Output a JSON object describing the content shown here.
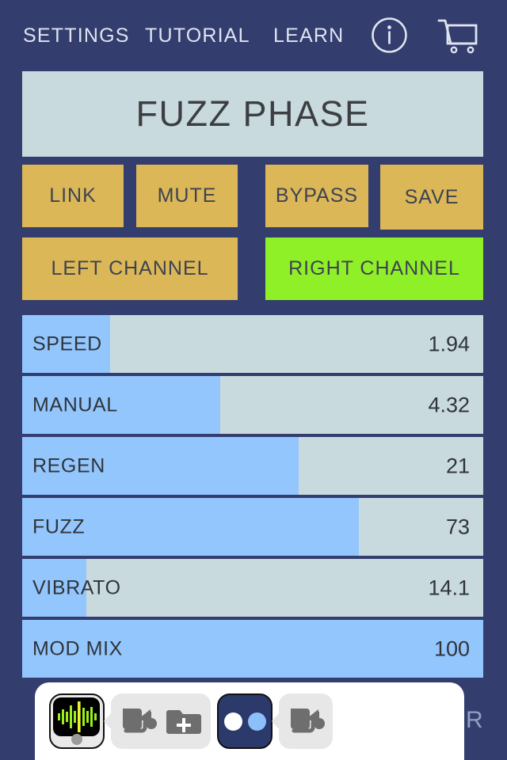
{
  "app": {
    "background_color": "#333d6e",
    "title": "FUZZ PHASE"
  },
  "topnav": {
    "settings_label": "SETTINGS",
    "tutorial_label": "TUTORIAL",
    "learn_label": "LEARN",
    "info_icon": "info-circle-icon",
    "cart_icon": "shopping-cart-icon"
  },
  "actions": {
    "link_label": "LINK",
    "mute_label": "MUTE",
    "bypass_label": "BYPASS",
    "save_label": "SAVE",
    "inactive_color": "#dcb757",
    "active_color": "#90f028"
  },
  "channels": {
    "left_label": "LEFT CHANNEL",
    "right_label": "RIGHT CHANNEL",
    "selected": "RIGHT CHANNEL"
  },
  "parameters": [
    {
      "name": "SPEED",
      "value": "1.94",
      "fill_percent": 19
    },
    {
      "name": "MANUAL",
      "value": "4.32",
      "fill_percent": 43
    },
    {
      "name": "REGEN",
      "value": "21",
      "fill_percent": 60
    },
    {
      "name": "FUZZ",
      "value": "73",
      "fill_percent": 73
    },
    {
      "name": "VIBRATO",
      "value": "14.1",
      "fill_percent": 14
    },
    {
      "name": "MOD MIX",
      "value": "100",
      "fill_percent": 100
    }
  ],
  "slider_colors": {
    "track": "#c9dade",
    "fill": "#93c6fd"
  },
  "dock": {
    "host_app_icon": "audio-waveform-app-icon",
    "preset_share_icon": "audio-unit-share-icon",
    "add_folder_icon": "folder-plus-icon",
    "dots_app_icon": "two-dots-app-icon",
    "second_share_icon": "audio-unit-share-icon",
    "cut_off_label": "R"
  }
}
